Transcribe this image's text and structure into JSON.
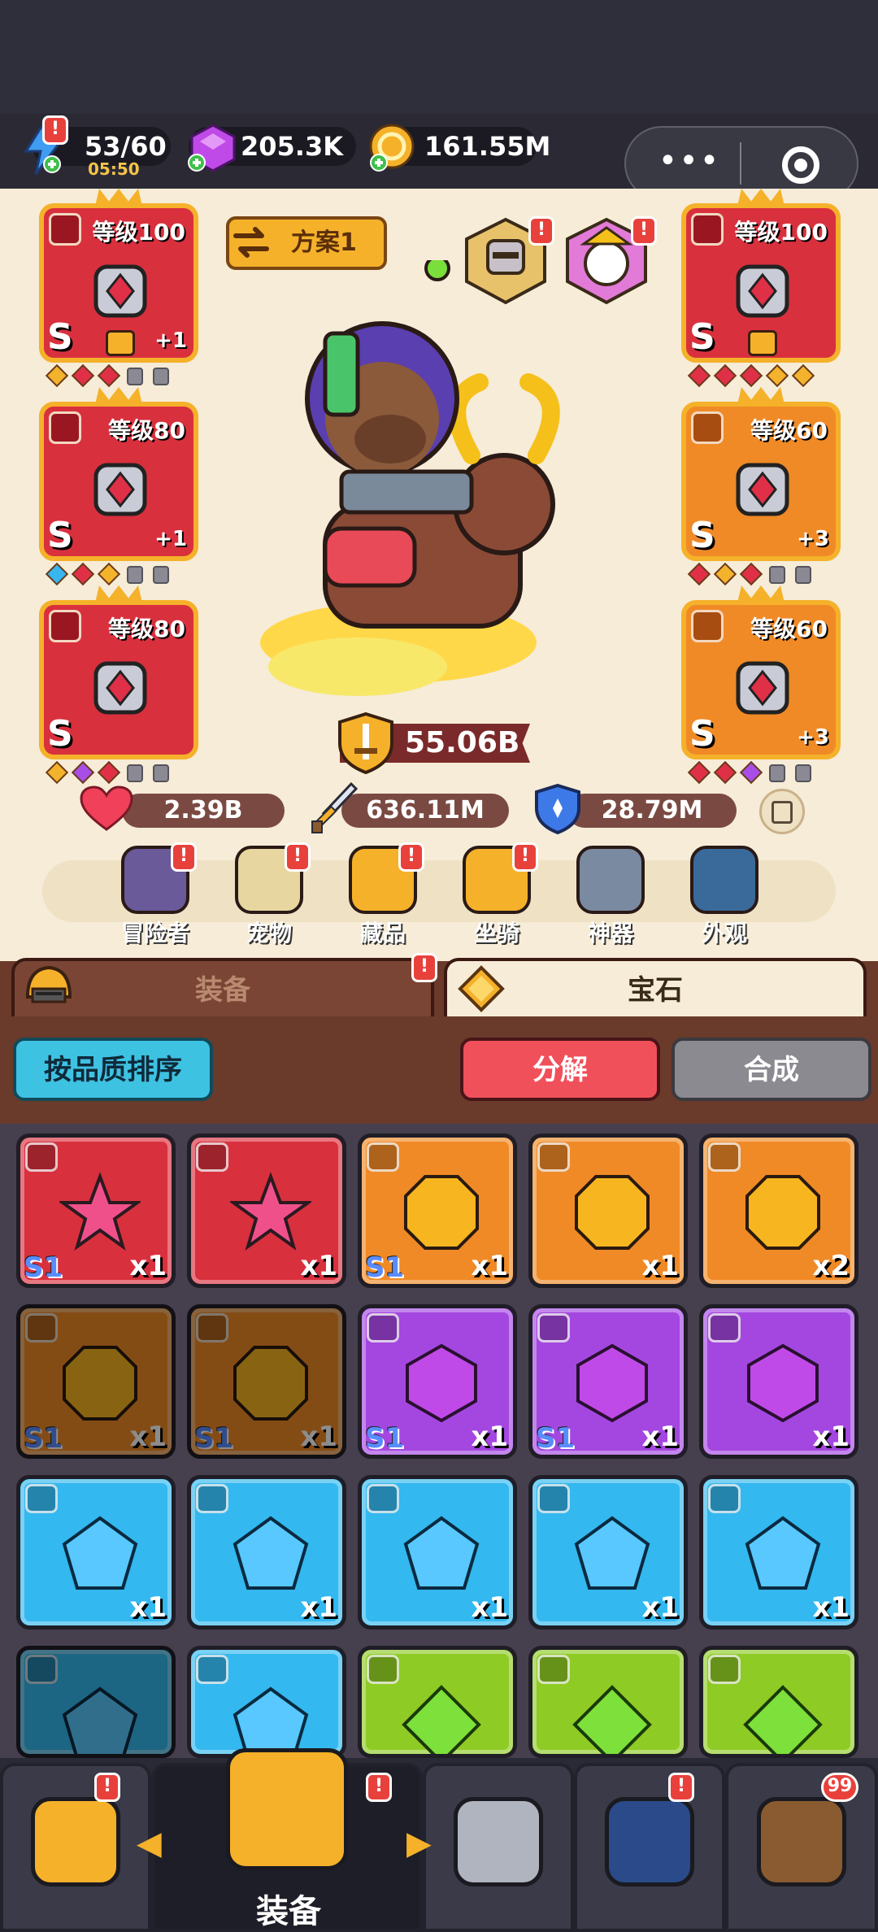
{
  "resources": {
    "energy": {
      "value": "53/60",
      "timer": "05:50",
      "icon": "lightning-icon"
    },
    "gems": {
      "value": "205.3K",
      "icon": "purple-gem-icon"
    },
    "coins": {
      "value": "161.55M",
      "icon": "gold-coin-icon"
    }
  },
  "loadout": {
    "label": "方案1"
  },
  "equipment": {
    "left": [
      {
        "level": "等级100",
        "grade": "S",
        "plus": "+1",
        "icon": "crossbow-icon",
        "type_icon": "sword-icon",
        "locked": true,
        "sockets": [
          "#f4b32c",
          "#e03048",
          "#e03048",
          "lock",
          "lock"
        ]
      },
      {
        "level": "等级80",
        "grade": "S",
        "plus": "+1",
        "icon": "crystal-ring-icon",
        "type_icon": "ring-icon",
        "locked": false,
        "sockets": [
          "#38b6f0",
          "#e03048",
          "#f4b32c",
          "lock",
          "lock"
        ]
      },
      {
        "level": "等级80",
        "grade": "S",
        "plus": "",
        "icon": "chalice-amulet-icon",
        "type_icon": "necklace-icon",
        "locked": false,
        "sockets": [
          "#f4b32c",
          "#a84de6",
          "#e03048",
          "lock",
          "lock"
        ]
      }
    ],
    "right": [
      {
        "level": "等级100",
        "grade": "S",
        "plus": "",
        "icon": "dark-armor-icon",
        "type_icon": "armor-icon",
        "locked": true,
        "sockets": [
          "#e03048",
          "#e03048",
          "#e03048",
          "#f4b32c",
          "#f4b32c"
        ]
      },
      {
        "level": "等级60",
        "grade": "S",
        "plus": "+3",
        "icon": "ruby-ring-icon",
        "type_icon": "ring-icon",
        "locked": false,
        "sockets": [
          "#e03048",
          "#f4b32c",
          "#e03048",
          "lock",
          "lock"
        ]
      },
      {
        "level": "等级60",
        "grade": "S",
        "plus": "+3",
        "icon": "chalice-amulet-icon",
        "type_icon": "necklace-icon",
        "locked": false,
        "sockets": [
          "#e03048",
          "#e03048",
          "#a84de6",
          "lock",
          "lock"
        ]
      }
    ]
  },
  "power": {
    "value": "55.06B",
    "icon": "sword-shield-icon"
  },
  "stats": {
    "hp": {
      "value": "2.39B",
      "icon": "heart-icon"
    },
    "atk": {
      "value": "636.11M",
      "icon": "sword-icon"
    },
    "def": {
      "value": "28.79M",
      "icon": "shield-icon"
    }
  },
  "categories": [
    {
      "label": "冒险者",
      "icon": "adventurer-icon",
      "badge": "!"
    },
    {
      "label": "宠物",
      "icon": "pet-egg-icon",
      "badge": "!"
    },
    {
      "label": "藏品",
      "icon": "collection-chalice-icon",
      "badge": "!"
    },
    {
      "label": "坐骑",
      "icon": "horseshoe-icon",
      "badge": "!"
    },
    {
      "label": "神器",
      "icon": "hammer-icon",
      "badge": ""
    },
    {
      "label": "外观",
      "icon": "outfit-icon",
      "badge": ""
    }
  ],
  "tabs": {
    "equipment": "装备",
    "gems": "宝石",
    "active": "gems"
  },
  "toolbar": {
    "sort": "按品质排序",
    "decompose": "分解",
    "combine": "合成"
  },
  "gem_grid": [
    {
      "color": "red",
      "shape": "star",
      "type": "ring",
      "tier": "S1",
      "count": "x1",
      "dim": false
    },
    {
      "color": "red",
      "shape": "star",
      "type": "ring",
      "tier": "",
      "count": "x1",
      "dim": false
    },
    {
      "color": "orange",
      "shape": "octagon",
      "type": "necklace",
      "tier": "S1",
      "count": "x1",
      "dim": false
    },
    {
      "color": "orange",
      "shape": "octagon",
      "type": "armor",
      "tier": "",
      "count": "x1",
      "dim": false
    },
    {
      "color": "orange",
      "shape": "octagon",
      "type": "armor",
      "tier": "",
      "count": "x2",
      "dim": false
    },
    {
      "color": "orange",
      "shape": "octagon",
      "type": "sword",
      "tier": "S1",
      "count": "x1",
      "dim": true
    },
    {
      "color": "orange",
      "shape": "octagon",
      "type": "sword",
      "tier": "S1",
      "count": "x1",
      "dim": true
    },
    {
      "color": "purple",
      "shape": "hexagon",
      "type": "necklace",
      "tier": "S1",
      "count": "x1",
      "dim": false
    },
    {
      "color": "purple",
      "shape": "hexagon",
      "type": "ring",
      "tier": "S1",
      "count": "x1",
      "dim": false
    },
    {
      "color": "purple",
      "shape": "hexagon",
      "type": "ring",
      "tier": "",
      "count": "x1",
      "dim": false
    },
    {
      "color": "blue",
      "shape": "pentagon",
      "type": "necklace",
      "tier": "",
      "count": "x1",
      "dim": false
    },
    {
      "color": "blue",
      "shape": "pentagon",
      "type": "ring",
      "tier": "",
      "count": "x1",
      "dim": false
    },
    {
      "color": "blue",
      "shape": "pentagon",
      "type": "ring",
      "tier": "",
      "count": "x1",
      "dim": false
    },
    {
      "color": "blue",
      "shape": "pentagon",
      "type": "ring",
      "tier": "",
      "count": "x1",
      "dim": false
    },
    {
      "color": "blue",
      "shape": "pentagon",
      "type": "ring",
      "tier": "",
      "count": "x1",
      "dim": false
    },
    {
      "color": "blue",
      "shape": "pentagon",
      "type": "sword",
      "tier": "",
      "count": "",
      "dim": true
    },
    {
      "color": "blue",
      "shape": "pentagon",
      "type": "sword",
      "tier": "",
      "count": "",
      "dim": false
    },
    {
      "color": "green",
      "shape": "diamond",
      "type": "necklace",
      "tier": "",
      "count": "",
      "dim": false
    },
    {
      "color": "green",
      "shape": "diamond",
      "type": "ring",
      "tier": "",
      "count": "",
      "dim": false
    },
    {
      "color": "green",
      "shape": "diamond",
      "type": "ring",
      "tier": "",
      "count": "",
      "dim": false
    }
  ],
  "bottom_nav": [
    {
      "icon": "shop-icon",
      "badge": "!",
      "label": ""
    },
    {
      "icon": "equipment-helmet-icon",
      "badge": "!",
      "label": "装备"
    },
    {
      "icon": "battle-swords-icon",
      "badge": "",
      "label": ""
    },
    {
      "icon": "upgrade-arrow-icon",
      "badge": "!",
      "label": ""
    },
    {
      "icon": "treasure-chest-icon",
      "badge": "99",
      "label": ""
    }
  ],
  "colors": {
    "red": "#d9303e",
    "orange": "#f08a26",
    "purple": "#a447e0",
    "blue": "#33b8ef",
    "green": "#8fcb25",
    "gem_red": "#f0508a",
    "gem_orange": "#f7b520",
    "gem_purple": "#c04ae8",
    "gem_blue": "#58c8ff",
    "gem_green": "#7ee03a"
  }
}
